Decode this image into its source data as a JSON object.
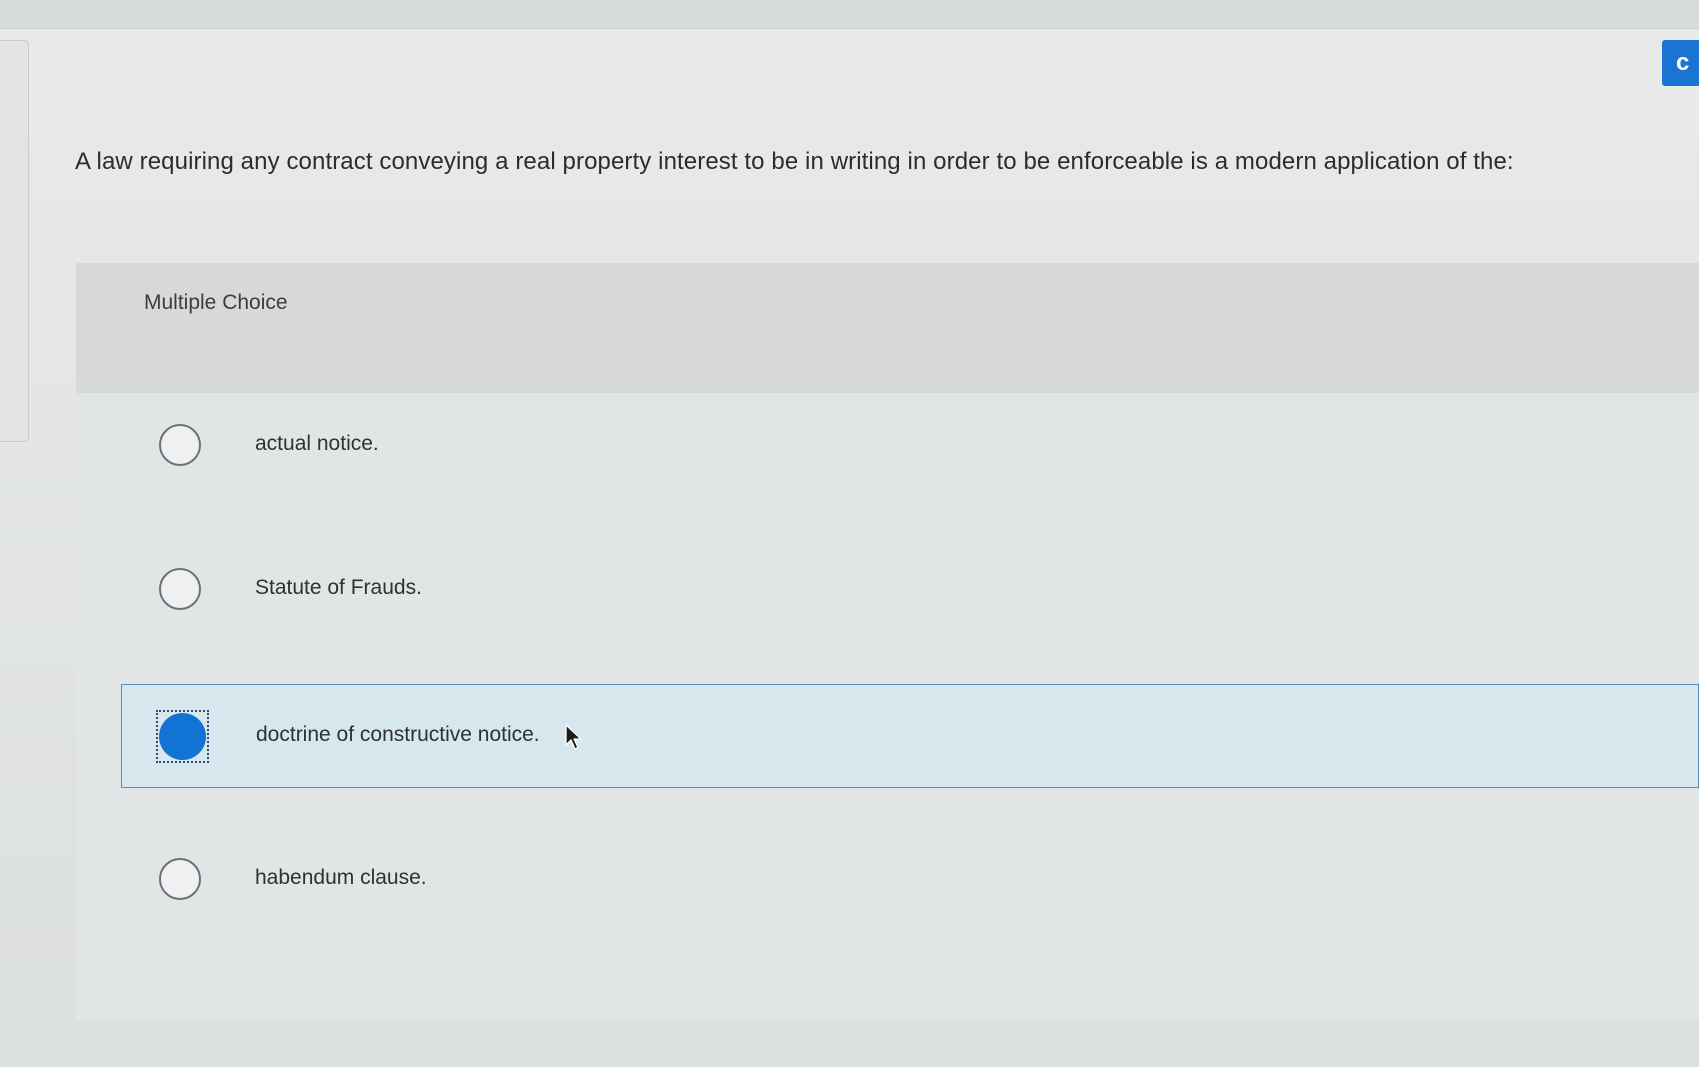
{
  "question": {
    "text": "A law requiring any contract conveying a real property interest to be in writing in order to be enforceable is a modern application of the:"
  },
  "card": {
    "label": "Multiple Choice"
  },
  "options": [
    {
      "label": "actual notice.",
      "selected": false
    },
    {
      "label": "Statute of Frauds.",
      "selected": false
    },
    {
      "label": "doctrine of constructive notice.",
      "selected": true
    },
    {
      "label": "habendum clause.",
      "selected": false
    }
  ],
  "colors": {
    "accent": "#1173d4",
    "selected_background": "#d8e6ee",
    "selected_border": "#5b8ab0"
  },
  "icons": {
    "cursor": "mouse-pointer-icon",
    "radio": "radio-button-icon"
  }
}
